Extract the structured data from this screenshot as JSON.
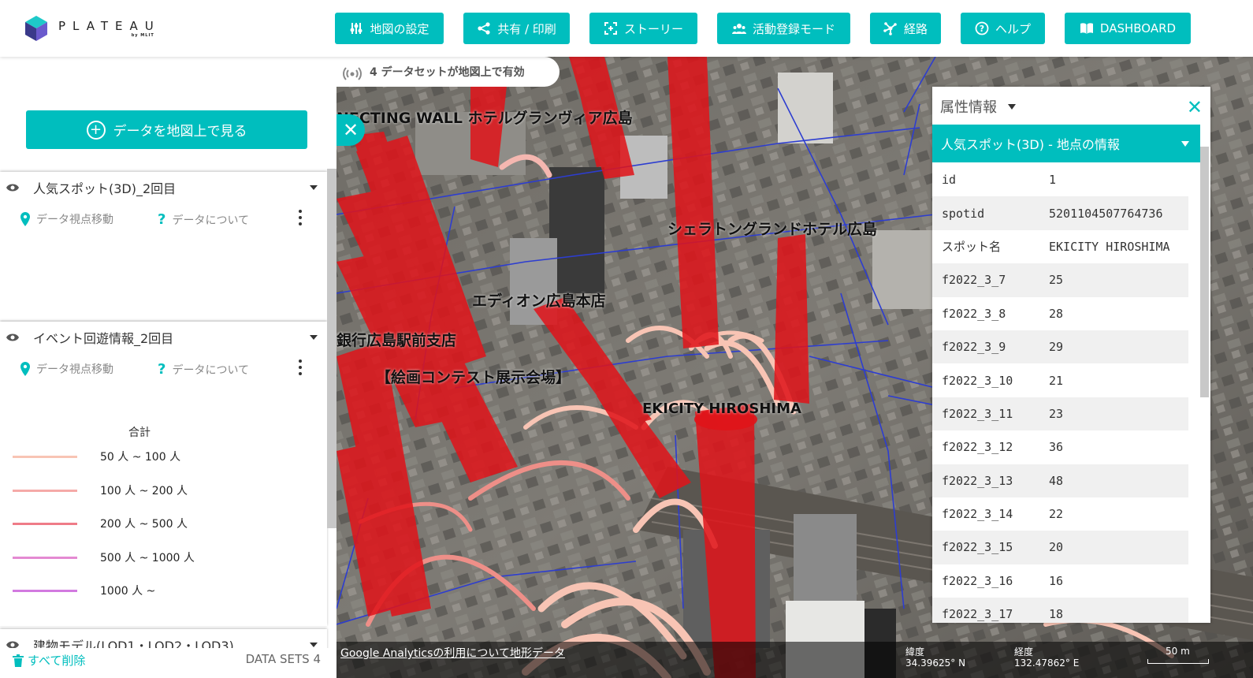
{
  "header": {
    "logo_text": "PLATEAU",
    "logo_sub": "by MLIT",
    "buttons": [
      {
        "label": "地図の設定",
        "icon": "sliders-icon"
      },
      {
        "label": "共有 / 印刷",
        "icon": "share-icon"
      },
      {
        "label": "ストーリー",
        "icon": "story-icon"
      },
      {
        "label": "活動登録モード",
        "icon": "users-icon"
      },
      {
        "label": "経路",
        "icon": "route-icon"
      },
      {
        "label": "ヘルプ",
        "icon": "help-icon"
      },
      {
        "label": "DASHBOARD",
        "icon": "book-icon"
      }
    ]
  },
  "sidebar": {
    "view_button": "データを地図上で見る",
    "layers": [
      {
        "title": "人気スポット(3D)_2回目",
        "zoom_label": "データ視点移動",
        "about_label": "データについて"
      },
      {
        "title": "イベント回遊情報_2回目",
        "zoom_label": "データ視点移動",
        "about_label": "データについて"
      },
      {
        "title": "建物モデル(LOD1・LOD2・LOD3)"
      }
    ],
    "legend": {
      "title": "合計",
      "items": [
        {
          "label": "50 人 ~ 100 人",
          "color": "#f8c4b4"
        },
        {
          "label": "100 人 ~ 200 人",
          "color": "#f5aaa8"
        },
        {
          "label": "200 人 ~ 500 人",
          "color": "#ef7c88"
        },
        {
          "label": "500 人 ~ 1000 人",
          "color": "#e48ad2"
        },
        {
          "label": "1000 人 ~",
          "color": "#d27ae0"
        }
      ]
    },
    "delete_all": "すべて削除",
    "datasets_count": "DATA SETS 4"
  },
  "map": {
    "active_datasets": "4 データセットが地図上で有効",
    "labels": [
      "NECTING WALL ホテルグランヴィア広島",
      "シェラトングランドホテル広島",
      "エディオン広島本店",
      "銀行広島駅前支店",
      "【絵画コンテスト展示会場】",
      "EKICITY HIROSHIMA"
    ],
    "footer": {
      "analytics_link": "Google Analyticsの利用について",
      "terrain_link": "地形データ",
      "lat_label": "緯度",
      "lat_value": "34.39625° N",
      "lon_label": "経度",
      "lon_value": "132.47862° E",
      "scale": "50 m"
    }
  },
  "feature_info": {
    "title": "属性情報",
    "subtitle": "人気スポット(3D) - 地点の情報",
    "rows": [
      {
        "key": "id",
        "value": "1"
      },
      {
        "key": "spotid",
        "value": "5201104507764736"
      },
      {
        "key": "スポット名",
        "value": "EKICITY HIROSHIMA"
      },
      {
        "key": "f2022_3_7",
        "value": "25"
      },
      {
        "key": "f2022_3_8",
        "value": "28"
      },
      {
        "key": "f2022_3_9",
        "value": "29"
      },
      {
        "key": "f2022_3_10",
        "value": "21"
      },
      {
        "key": "f2022_3_11",
        "value": "23"
      },
      {
        "key": "f2022_3_12",
        "value": "36"
      },
      {
        "key": "f2022_3_13",
        "value": "48"
      },
      {
        "key": "f2022_3_14",
        "value": "22"
      },
      {
        "key": "f2022_3_15",
        "value": "20"
      },
      {
        "key": "f2022_3_16",
        "value": "16"
      },
      {
        "key": "f2022_3_17",
        "value": "18"
      }
    ]
  },
  "colors": {
    "accent": "#00bebe",
    "bar_red": "#e0141a"
  }
}
